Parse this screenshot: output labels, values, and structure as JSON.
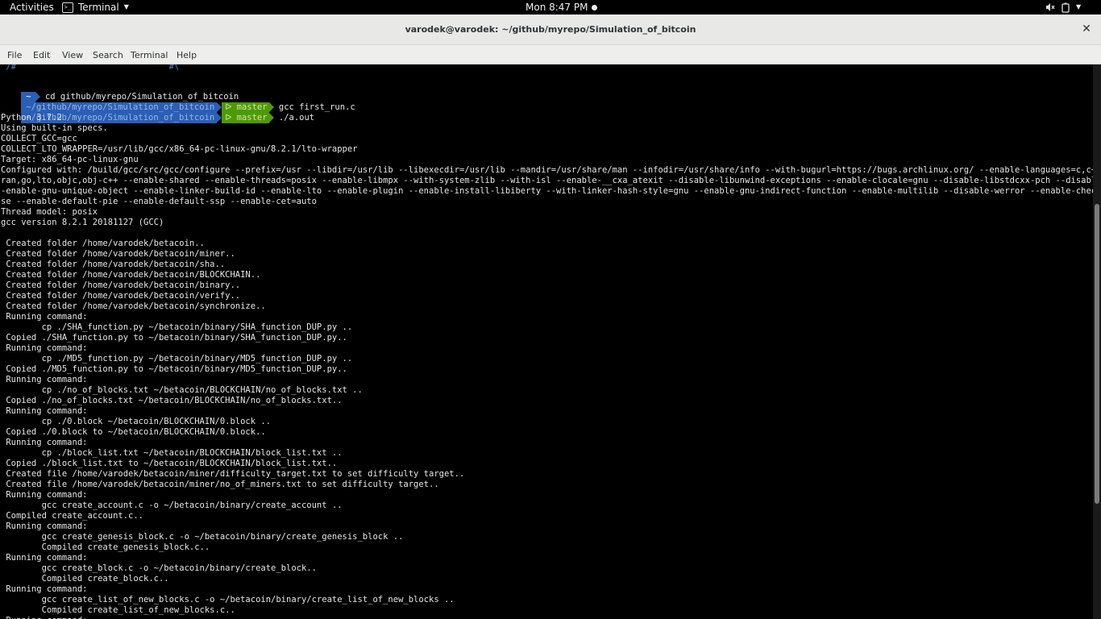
{
  "topbar": {
    "activities": "Activities",
    "app_name": "Terminal",
    "clock": "Mon  8:47 PM"
  },
  "window": {
    "title": "varodek@varodek: ~/github/myrepo/Simulation_of_bitcoin"
  },
  "menubar": {
    "items": [
      "File",
      "Edit",
      "View",
      "Search",
      "Terminal",
      "Help"
    ]
  },
  "terminal": {
    "partial_top": " /#                              #\\",
    "prompt": {
      "home": "~",
      "path": "~/github/myrepo/Simulation_of_bitcoin",
      "branch": "master",
      "branch_glyph": "ᐅ"
    },
    "commands": [
      "cd github/myrepo/Simulation_of_bitcoin",
      "gcc first_run.c",
      "./a.out"
    ],
    "output": [
      "Python 3.7.2",
      "Using built-in specs.",
      "COLLECT_GCC=gcc",
      "COLLECT_LTO_WRAPPER=/usr/lib/gcc/x86_64-pc-linux-gnu/8.2.1/lto-wrapper",
      "Target: x86_64-pc-linux-gnu",
      "Configured with: /build/gcc/src/gcc/configure --prefix=/usr --libdir=/usr/lib --libexecdir=/usr/lib --mandir=/usr/share/man --infodir=/usr/share/info --with-bugurl=https://bugs.archlinux.org/ --enable-languages=c,c++,ada,fort",
      "ran,go,lto,objc,obj-c++ --enable-shared --enable-threads=posix --enable-libmpx --with-system-zlib --with-isl --enable-__cxa_atexit --disable-libunwind-exceptions --enable-clocale=gnu --disable-libstdcxx-pch --disable-libssp -",
      "-enable-gnu-unique-object --enable-linker-build-id --enable-lto --enable-plugin --enable-install-libiberty --with-linker-hash-style=gnu --enable-gnu-indirect-function --enable-multilib --disable-werror --enable-checking=relea",
      "se --enable-default-pie --enable-default-ssp --enable-cet=auto",
      "Thread model: posix",
      "gcc version 8.2.1 20181127 (GCC)",
      "",
      " Created folder /home/varodek/betacoin..",
      " Created folder /home/varodek/betacoin/miner..",
      " Created folder /home/varodek/betacoin/sha..",
      " Created folder /home/varodek/betacoin/BLOCKCHAIN..",
      " Created folder /home/varodek/betacoin/binary..",
      " Created folder /home/varodek/betacoin/verify..",
      " Created folder /home/varodek/betacoin/synchronize..",
      " Running command:",
      "        cp ./SHA_function.py ~/betacoin/binary/SHA_function_DUP.py ..",
      " Copied ./SHA_function.py to ~/betacoin/binary/SHA_function_DUP.py..",
      " Running command:",
      "        cp ./MD5_function.py ~/betacoin/binary/MD5_function_DUP.py ..",
      " Copied ./MD5_function.py to ~/betacoin/binary/MD5_function_DUP.py..",
      " Running command:",
      "        cp ./no_of_blocks.txt ~/betacoin/BLOCKCHAIN/no_of_blocks.txt ..",
      " Copied ./no_of_blocks.txt ~/betacoin/BLOCKCHAIN/no_of_blocks.txt..",
      " Running command:",
      "        cp ./0.block ~/betacoin/BLOCKCHAIN/0.block ..",
      " Copied ./0.block to ~/betacoin/BLOCKCHAIN/0.block..",
      " Running command:",
      "        cp ./block_list.txt ~/betacoin/BLOCKCHAIN/block_list.txt ..",
      " Copied ./block_list.txt to ~/betacoin/BLOCKCHAIN/block_list.txt..",
      " Created file /home/varodek/betacoin/miner/difficulty_target.txt to set difficulty target..",
      " Created file /home/varodek/betacoin/miner/no_of_miners.txt to set difficulty target..",
      " Running command:",
      "        gcc create_account.c -o ~/betacoin/binary/create_account ..",
      " Compiled create_account.c..",
      " Running command:",
      "        gcc create_genesis_block.c -o ~/betacoin/binary/create_genesis_block ..",
      "        Compiled create_genesis_block.c..",
      " Running command:",
      "        gcc create_block.c -o ~/betacoin/binary/create_block..",
      "        Compiled create_block.c..",
      " Running command:",
      "        gcc create_list_of_new_blocks.c -o ~/betacoin/binary/create_list_of_new_blocks ..",
      "        Compiled create_list_of_new_blocks.c..",
      " Running command:"
    ]
  },
  "icons": {
    "terminal_app": "terminal-icon",
    "app_menu_caret": "chevron-down-icon",
    "notification_dot": "notification-dot-icon",
    "volume": "volume-muted-icon",
    "battery": "battery-icon",
    "system_menu": "chevron-down-icon",
    "close": "close-icon"
  },
  "scrollbar": {
    "position_fraction": 0.25,
    "visible_fraction": 0.54
  }
}
